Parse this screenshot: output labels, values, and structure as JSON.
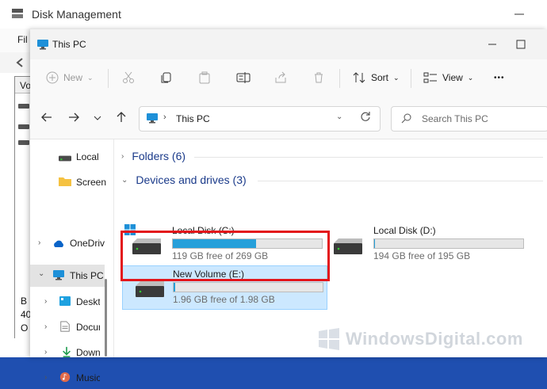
{
  "background_window": {
    "title": "Disk Management",
    "menu_label": "Fil",
    "list_header": "Vo",
    "bottom_lines": [
      "B",
      "40",
      "O"
    ]
  },
  "window": {
    "title": "This PC"
  },
  "commands": {
    "new_label": "New",
    "sort_label": "Sort",
    "view_label": "View",
    "more_label": "•••"
  },
  "address": {
    "path": "This PC"
  },
  "search": {
    "placeholder": "Search This PC"
  },
  "nav": {
    "items": [
      {
        "label": "Local",
        "icon": "drive-icon"
      },
      {
        "label": "Screen",
        "icon": "folder-icon"
      },
      {
        "label": "OneDriv",
        "icon": "onedrive-icon"
      },
      {
        "label": "This PC",
        "icon": "this-pc-icon"
      },
      {
        "label": "Deskt",
        "icon": "desktop-icon"
      },
      {
        "label": "Docun",
        "icon": "documents-icon"
      },
      {
        "label": "Down",
        "icon": "downloads-icon"
      },
      {
        "label": "Music",
        "icon": "music-icon"
      }
    ]
  },
  "groups": {
    "folders": "Folders (6)",
    "devices": "Devices and drives (3)"
  },
  "drives": [
    {
      "name": "Local Disk (C:)",
      "free_text": "119 GB free of 269 GB",
      "used_fraction": 0.56
    },
    {
      "name": "Local Disk (D:)",
      "free_text": "194 GB free of 195 GB",
      "used_fraction": 0.005
    },
    {
      "name": "New Volume (E:)",
      "free_text": "1.96 GB free of 1.98 GB",
      "used_fraction": 0.01
    }
  ],
  "watermark": "WindowsDigital.com",
  "colors": {
    "accent": "#26a0da",
    "selection": "#cce8ff",
    "highlight_box": "#e3161b",
    "group_text": "#1a3a8a"
  }
}
